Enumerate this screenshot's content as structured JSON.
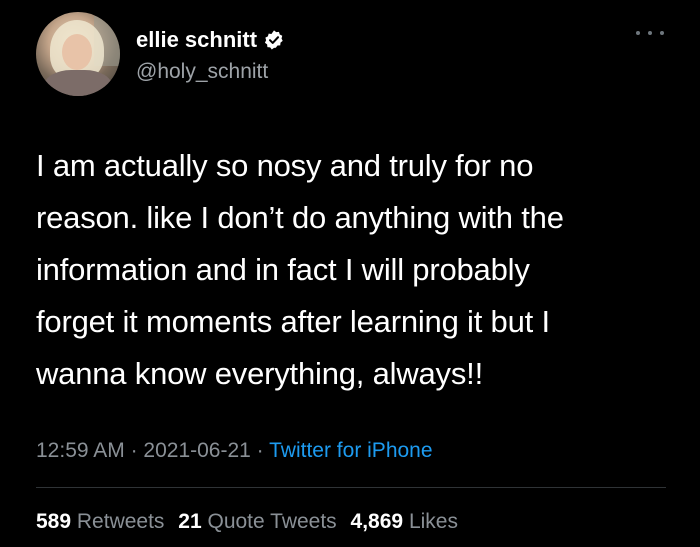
{
  "user": {
    "display_name": "ellie schnitt",
    "handle": "@holy_schnitt",
    "verified": true
  },
  "tweet": {
    "lines": [
      "I am actually so nosy and truly for no",
      "reason. like I don’t do anything with the",
      "information and in fact I will probably",
      "forget it moments after learning it but I",
      "wanna know everything, always!!"
    ]
  },
  "meta": {
    "time": "12:59 AM",
    "separator": " · ",
    "date": "2021-06-21",
    "source": "Twitter for iPhone"
  },
  "stats": {
    "retweets_count": "589",
    "retweets_label": "Retweets",
    "quotes_count": "21",
    "quotes_label": "Quote Tweets",
    "likes_count": "4,869",
    "likes_label": "Likes"
  },
  "icons": {
    "verified": "verified-badge-icon",
    "more": "more-options-icon"
  },
  "colors": {
    "background": "#000000",
    "text": "#ffffff",
    "secondary": "#8a9096",
    "link": "#1d9bf0",
    "divider": "#2f3336"
  }
}
